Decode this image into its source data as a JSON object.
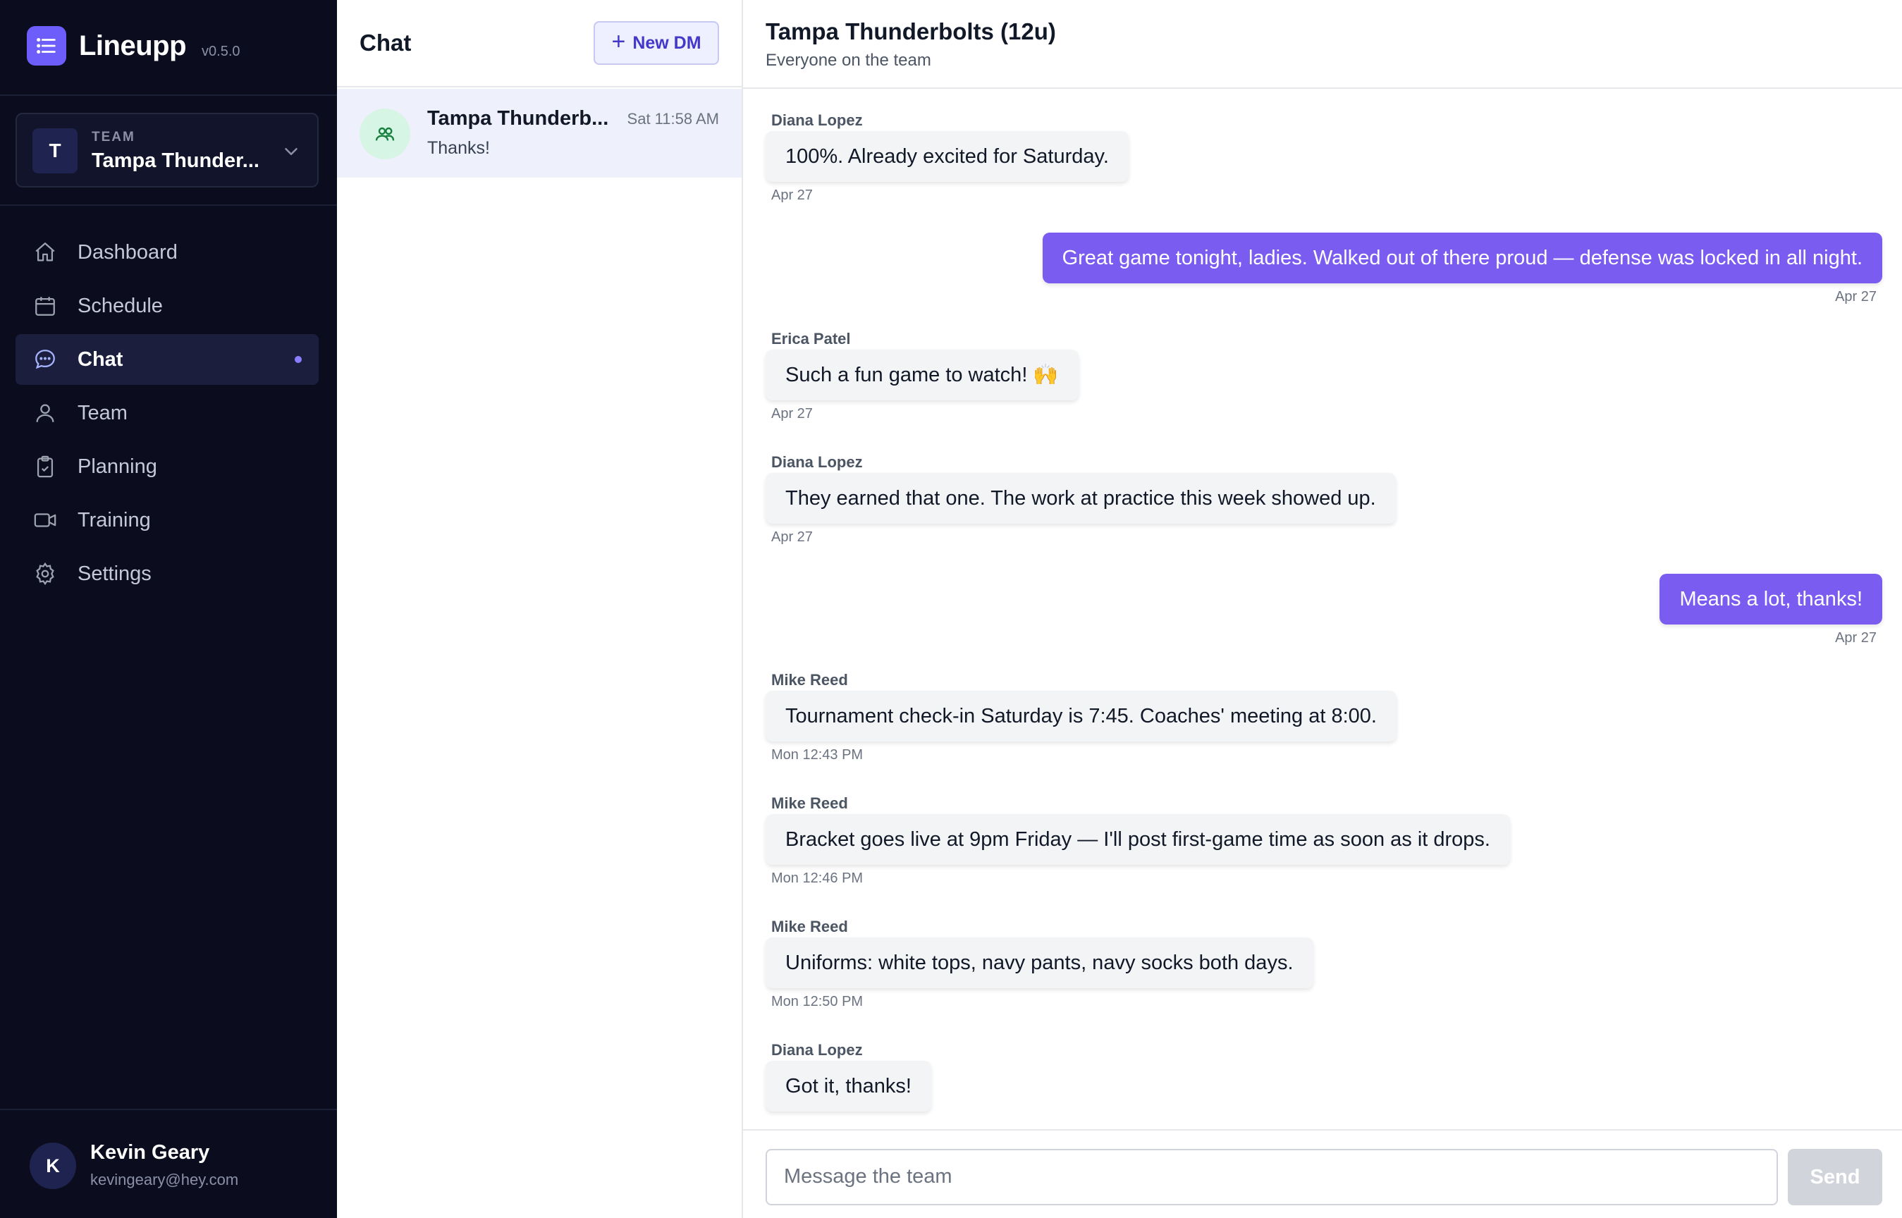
{
  "brand": {
    "name": "Lineupp",
    "version": "v0.5.0"
  },
  "team_switcher": {
    "kicker": "TEAM",
    "avatar_letter": "T",
    "name": "Tampa Thunder..."
  },
  "nav": [
    {
      "label": "Dashboard",
      "icon": "home-icon"
    },
    {
      "label": "Schedule",
      "icon": "calendar-icon"
    },
    {
      "label": "Chat",
      "icon": "chat-bubble-icon",
      "active": true,
      "unread": true
    },
    {
      "label": "Team",
      "icon": "user-icon"
    },
    {
      "label": "Planning",
      "icon": "clipboard-icon"
    },
    {
      "label": "Training",
      "icon": "video-camera-icon"
    },
    {
      "label": "Settings",
      "icon": "gear-icon"
    }
  ],
  "user": {
    "initial": "K",
    "name": "Kevin Geary",
    "email": "kevingeary@hey.com"
  },
  "conversation_list": {
    "title": "Chat",
    "new_dm_label": "New DM",
    "items": [
      {
        "name": "Tampa Thunderb...",
        "time": "Sat 11:58 AM",
        "preview": "Thanks!",
        "icon": "group-icon"
      }
    ]
  },
  "thread": {
    "title": "Tampa Thunderbolts (12u)",
    "subtitle": "Everyone on the team",
    "messages": [
      {
        "sender": "Diana Lopez",
        "text": "100%. Already excited for Saturday.",
        "time": "Apr 27",
        "outgoing": false
      },
      {
        "sender": "",
        "text": "Great game tonight, ladies. Walked out of there proud — defense was locked in all night.",
        "time": "Apr 27",
        "outgoing": true
      },
      {
        "sender": "Erica Patel",
        "text": "Such a fun game to watch! 🙌",
        "time": "Apr 27",
        "outgoing": false
      },
      {
        "sender": "Diana Lopez",
        "text": "They earned that one. The work at practice this week showed up.",
        "time": "Apr 27",
        "outgoing": false
      },
      {
        "sender": "",
        "text": "Means a lot, thanks!",
        "time": "Apr 27",
        "outgoing": true
      },
      {
        "sender": "Mike Reed",
        "text": "Tournament check-in Saturday is 7:45. Coaches' meeting at 8:00.",
        "time": "Mon 12:43 PM",
        "outgoing": false
      },
      {
        "sender": "Mike Reed",
        "text": "Bracket goes live at 9pm Friday — I'll post first-game time as soon as it drops.",
        "time": "Mon 12:46 PM",
        "outgoing": false
      },
      {
        "sender": "Mike Reed",
        "text": "Uniforms: white tops, navy pants, navy socks both days.",
        "time": "Mon 12:50 PM",
        "outgoing": false
      },
      {
        "sender": "Diana Lopez",
        "text": "Got it, thanks!",
        "time": "",
        "outgoing": false
      }
    ]
  },
  "composer": {
    "placeholder": "Message the team",
    "send_label": "Send"
  },
  "colors": {
    "sidebar_bg": "#0b0d1f",
    "accent": "#7a5cf0",
    "brand": "#6d5efc"
  }
}
